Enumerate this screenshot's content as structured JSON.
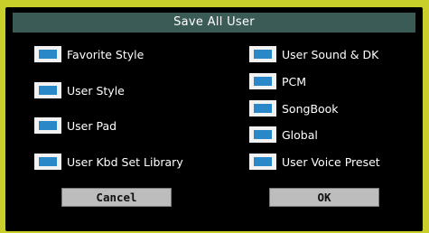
{
  "dialog": {
    "title": "Save All User",
    "left_options": [
      {
        "label": "Favorite Style",
        "checked": true
      },
      {
        "label": "User Style",
        "checked": true
      },
      {
        "label": "User Pad",
        "checked": true
      },
      {
        "label": "User Kbd Set Library",
        "checked": true
      }
    ],
    "right_options": [
      {
        "label": "User Sound & DK",
        "checked": true
      },
      {
        "label": "PCM",
        "checked": true
      },
      {
        "label": "SongBook",
        "checked": true
      },
      {
        "label": "Global",
        "checked": true
      },
      {
        "label": "User Voice Preset",
        "checked": true
      }
    ],
    "buttons": {
      "cancel_label": "Cancel",
      "ok_label": "OK"
    }
  },
  "colors": {
    "frame": "#c8cf2a",
    "panel": "#000000",
    "title_bar": "#3b5b57",
    "checkbox_fill": "#2b88c8",
    "checkbox_bg": "#f2f2f2",
    "button_bg": "#bdbdbd"
  }
}
